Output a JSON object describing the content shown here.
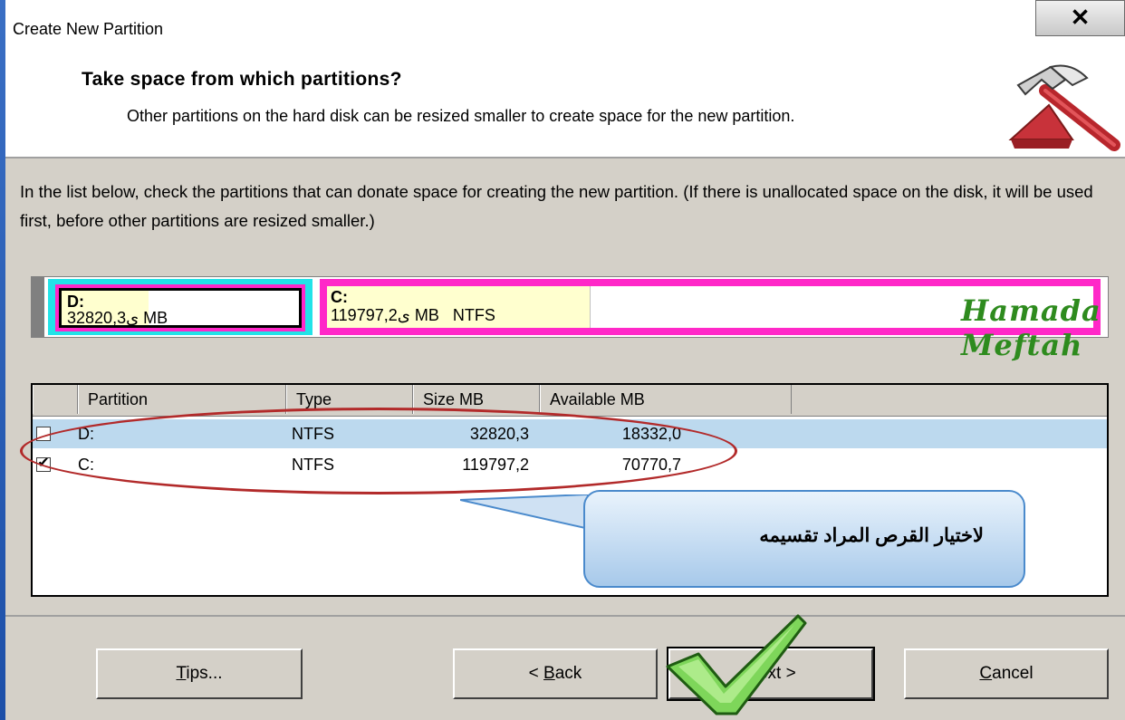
{
  "window": {
    "title": "Create New Partition",
    "close_glyph": "✕"
  },
  "header": {
    "title": "Take space from which partitions?",
    "description": "Other partitions on the hard disk can be resized smaller to create space for the new partition."
  },
  "body_text": "In the list below, check the partitions that can donate space for creating the new partition. (If there is unallocated space on the disk, it will be used first, before other partitions are resized smaller.)",
  "disk_map": {
    "partitions": [
      {
        "label": "D:",
        "size_text": "32ى820,3 MB"
      },
      {
        "label": "C:",
        "size_text": "119ى797,2 MB   NTFS"
      }
    ],
    "watermark": "Hamada Meftah"
  },
  "list": {
    "columns": [
      "Partition",
      "Type",
      "Size MB",
      "Available MB"
    ],
    "rows": [
      {
        "checked": false,
        "partition": "D:",
        "type": "NTFS",
        "size": "32820,3",
        "available": "18332,0"
      },
      {
        "checked": true,
        "partition": "C:",
        "type": "NTFS",
        "size": "119797,2",
        "available": "70770,7"
      }
    ]
  },
  "callout": {
    "text": "لاختيار القرص المراد تقسيمه"
  },
  "buttons": {
    "tips": {
      "hotkey": "T",
      "rest": "ips..."
    },
    "back": {
      "prefix": "< ",
      "hotkey": "B",
      "rest": "ack"
    },
    "next": {
      "label": "Next >"
    },
    "cancel": {
      "hotkey": "C",
      "rest": "ancel"
    }
  },
  "colors": {
    "d_partition_frame": "#22e3e8",
    "c_partition_frame": "#ff28c8",
    "annotation": "#b22a2a",
    "watermark": "#2e8b1e"
  }
}
